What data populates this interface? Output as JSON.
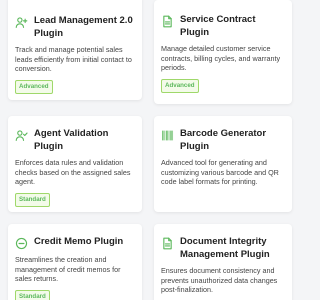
{
  "accent_color": "#5cb85c",
  "cards": [
    {
      "title": "Lead Management 2.0 Plugin",
      "description": "Track and manage potential sales leads efficiently from initial contact to conversion.",
      "badge": "Advanced",
      "icon": "user-add-icon"
    },
    {
      "title": "Service Contract Plugin",
      "description": "Manage detailed customer service contracts, billing cycles, and warranty periods.",
      "badge": "Advanced",
      "icon": "document-icon"
    },
    {
      "title": "Agent Validation Plugin",
      "description": "Enforces data rules and validation checks based on the assigned sales agent.",
      "badge": "Standard",
      "icon": "user-check-icon"
    },
    {
      "title": "Barcode Generator Plugin",
      "description": "Advanced tool for generating and customizing various barcode and QR code label formats for printing.",
      "badge": "",
      "icon": "barcode-icon"
    },
    {
      "title": "Credit Memo Plugin",
      "description": "Streamlines the creation and management of credit memos for sales returns.",
      "badge": "Standard",
      "icon": "minus-circle-icon"
    },
    {
      "title": "Document Integrity Management Plugin",
      "description": "Ensures document consistency and prevents unauthorized data changes post-finalization.",
      "badge": "",
      "icon": "document-icon"
    }
  ]
}
